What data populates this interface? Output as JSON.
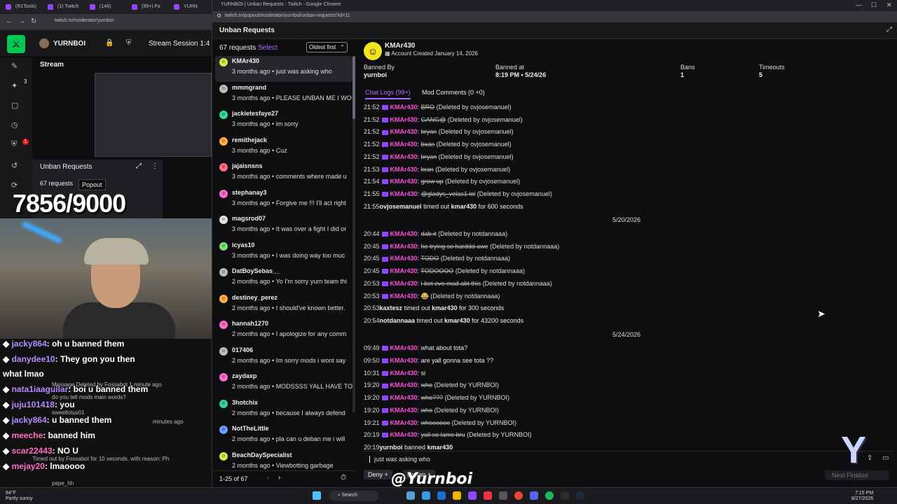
{
  "background": {
    "tabs": [
      "(R1Tools)",
      "(1) Twitch",
      "(146)",
      "(99+) Fo",
      "YURN"
    ],
    "url": "twitch.tv/moderator/yurnboi",
    "username": "YURNBOI",
    "session_label": "Stream Session 1:4",
    "stream_label": "Stream",
    "unban_label": "Unban Requests",
    "popout_tooltip": "Popout",
    "requests_label": "67 requests",
    "counter": "7856/9000",
    "sidebar_badges": [
      "3",
      "1"
    ],
    "chat": [
      {
        "user": "jacky864",
        "text": ": oh u banned them"
      },
      {
        "user": "danydee10",
        "text": ": They gon        you then"
      },
      {
        "user": "",
        "text": "what lmao"
      },
      {
        "user": "nata1iaaguilar",
        "text": ": boi u banned them"
      },
      {
        "user": "juju101418",
        "text": ": you"
      },
      {
        "user": "jacky864",
        "text": ": u banned them"
      },
      {
        "user": "meeche",
        "text": ": banned him"
      },
      {
        "user": "scar22443",
        "text": ": NO U"
      },
      {
        "user": "mejay20",
        "text": ": lmaoooo"
      }
    ],
    "chat_small": [
      "Message Deleted by Fossabot 1 minute ago",
      "do you tell mods main words?",
      "sweetlotus01",
      "minutes ago",
      "Timed out by Fossabot for 10 seconds, with reason: Ph",
      "pepe_hh"
    ]
  },
  "popout": {
    "window_title": "YURNBOI | Unban Requests - Twitch - Google Chrome",
    "url": "twitch.tv/popout/moderator/yurnboi/unban-requests?id=11",
    "page_title": "Unban Requests",
    "request_count": "67 requests",
    "select_label": "Select",
    "sort_label": "Oldest first",
    "requests": [
      {
        "name": "KMAr430",
        "meta": "3 months ago • just was asking who",
        "color": "#d7e84a"
      },
      {
        "name": "mmmgrand",
        "meta": "3 months ago • PLEASE UNBAN ME I WO",
        "color": "#bdbdbd"
      },
      {
        "name": "jackietesfaye27",
        "meta": "3 months ago • im sorry",
        "color": "#35d6a4"
      },
      {
        "name": "remithejack",
        "meta": "3 months ago • Cuz",
        "color": "#ffb04a"
      },
      {
        "name": "jajaisnsns",
        "meta": "3 months ago • comments where made u",
        "color": "#ff6b86"
      },
      {
        "name": "stephanay3",
        "meta": "3 months ago • Forgive me !!! I'll act right",
        "color": "#ff6bd1"
      },
      {
        "name": "magsrod07",
        "meta": "3 months ago • It was over a fight I did or",
        "color": "#e3e3e3"
      },
      {
        "name": "icyas10",
        "meta": "3 months ago • I was doing way too muc",
        "color": "#7be07b"
      },
      {
        "name": "DatBoySebas__",
        "meta": "2 months ago • Yo I'm sorry yurn team thi",
        "color": "#bdbdbd"
      },
      {
        "name": "destiney_perez",
        "meta": "2 months ago • I should've known better.",
        "color": "#ffb04a"
      },
      {
        "name": "hannah1270",
        "meta": "2 months ago • I apologize for any comm",
        "color": "#ff6bd1"
      },
      {
        "name": "017406",
        "meta": "2 months ago • Im sorry mods i wont say",
        "color": "#bdbdbd"
      },
      {
        "name": "zaydaxp",
        "meta": "2 months ago • MODSSSS YALL HAVE TO",
        "color": "#ff6bd1"
      },
      {
        "name": "3hotchix",
        "meta": "2 months ago • because I always defend",
        "color": "#35d6a4"
      },
      {
        "name": "NotTheLittle",
        "meta": "2 months ago • pla can u deban me i will",
        "color": "#6b9cff"
      },
      {
        "name": "BeachDaySpecialist",
        "meta": "2 months ago • Viewbotting garbage",
        "color": "#d7e84a"
      }
    ],
    "page_range": "1-25 of 67",
    "user": {
      "name": "KMAr430",
      "created": "Account Created January 14, 2026"
    },
    "stats": [
      {
        "label": "Banned By",
        "value": "yurnboi"
      },
      {
        "label": "Banned at",
        "value": "8:19 PM • 5/24/26"
      },
      {
        "label": "Bans",
        "value": "1"
      },
      {
        "label": "Timeouts",
        "value": "5"
      }
    ],
    "tabs": [
      "Chat Logs (99+)",
      "Mod Comments (0 +0)"
    ],
    "logs": [
      {
        "time": "21:52",
        "user": "KMAr430",
        "msg": "BRO",
        "note": "(Deleted by ovjosemanuel)"
      },
      {
        "time": "21:52",
        "user": "KMAr430",
        "msg": "GANG@",
        "note": "(Deleted by ovjosemanuel)"
      },
      {
        "time": "21:52",
        "user": "KMAr430",
        "msg": "bryan",
        "note": "(Deleted by ovjosemanuel)"
      },
      {
        "time": "21:52",
        "user": "KMAr430",
        "msg": "bxan",
        "note": "(Deleted by ovjosemanuel)"
      },
      {
        "time": "21:52",
        "user": "KMAr430",
        "msg": "bryan",
        "note": "(Deleted by ovjosemanuel)"
      },
      {
        "time": "21:53",
        "user": "KMAr430",
        "msg": "bran",
        "note": "(Deleted by ovjosemanuel)"
      },
      {
        "time": "21:54",
        "user": "KMAr430",
        "msg": "grow up",
        "note": "(Deleted by ovjosemanuel)"
      },
      {
        "time": "21:55",
        "user": "KMAr430",
        "msg": "@gladys_velas1  lol",
        "note": "(Deleted by ovjosemanuel)"
      }
    ],
    "timeout1": {
      "time": "21:55",
      "mod": "ovjosemanuel",
      "text": " timed out ",
      "target": "kmar430",
      "rest": " for 600 seconds"
    },
    "date1": "5/20/2026",
    "logs2": [
      {
        "time": "20:44",
        "user": "KMAr430",
        "msg": "dab it",
        "note": "(Deleted by notdannaaa)"
      },
      {
        "time": "20:45",
        "user": "KMAr430",
        "msg": "he trying so harddd awe",
        "note": "(Deleted by notdannaaa)"
      },
      {
        "time": "20:45",
        "user": "KMAr430",
        "msg": "TODO",
        "note": "(Deleted by notdannaaa)"
      },
      {
        "time": "20:45",
        "user": "KMAr430",
        "msg": "TODOOOO",
        "note": "(Deleted by notdannaaa)"
      },
      {
        "time": "20:53",
        "user": "KMAr430",
        "msg": "i bet eve mad abt this",
        "note": "(Deleted by notdannaaa)"
      },
      {
        "time": "20:53",
        "user": "KMAr430",
        "msg": "😂",
        "note": "(Deleted by notdannaaa)"
      }
    ],
    "timeout2": {
      "time": "20:53",
      "mod": "kaxtesz",
      "text": " timed out ",
      "target": "kmar430",
      "rest": " for 300 seconds"
    },
    "timeout3": {
      "time": "20:54",
      "mod": "notdannaaa",
      "text": " timed out ",
      "target": "kmar430",
      "rest": " for 43200 seconds"
    },
    "date2": "5/24/2026",
    "logs3": [
      {
        "time": "09:49",
        "user": "KMAr430",
        "msg": "what about tota?",
        "note": "",
        "plain": true
      },
      {
        "time": "09:50",
        "user": "KMAr430",
        "msg": "are yall gonna see tota ??",
        "note": "",
        "plain": true
      },
      {
        "time": "10:31",
        "user": "KMAr430",
        "msg": "si",
        "note": "",
        "plain": true
      },
      {
        "time": "19:20",
        "user": "KMAr430",
        "msg": "who",
        "note": "(Deleted by YURNBOI)"
      },
      {
        "time": "19:20",
        "user": "KMAr430",
        "msg": "who???",
        "note": "(Deleted by YURNBOI)"
      },
      {
        "time": "19:20",
        "user": "KMAr430",
        "msg": "who",
        "note": "(Deleted by YURNBOI)"
      },
      {
        "time": "19:21",
        "user": "KMAr430",
        "msg": "whoooooo",
        "note": "(Deleted by YURNBOI)"
      },
      {
        "time": "20:19",
        "user": "KMAr430",
        "msg": "yall so lame bru",
        "note": "(Deleted by YURNBOI)"
      }
    ],
    "ban": {
      "time": "20:19",
      "mod": "yurnboi",
      "text": " banned ",
      "target": "kmar430"
    },
    "composer_text": "just was asking who",
    "deny_label": "Deny",
    "unban_label": "Unban",
    "finalize_label": "Next  Finalize",
    "watermark": "@Yurnboi",
    "logo_letter": "Y"
  },
  "taskbar": {
    "weather_temp": "84°F",
    "weather_desc": "Partly sunny",
    "search_label": "Search",
    "time": "7:15 PM",
    "date": "8/27/2026"
  },
  "colors": {
    "accent": "#a970ff",
    "username_pink": "#ff4fd8",
    "badge": "#9147ff"
  }
}
